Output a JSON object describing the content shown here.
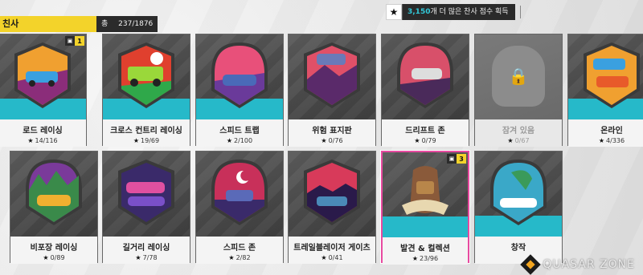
{
  "header": {
    "category_label": "친사",
    "total_label": "총",
    "total_value": "237/1876"
  },
  "notice": {
    "icon": "star-icon",
    "highlight": "3,150",
    "text": "개 더 많은 찬사 점수 획득"
  },
  "row1": [
    {
      "name": "로드 레이싱",
      "progress": "14/116",
      "count": "1",
      "icon": "road-racing-icon"
    },
    {
      "name": "크로스 컨트리 레이싱",
      "progress": "19/69",
      "icon": "cross-country-icon"
    },
    {
      "name": "스피드 트랩",
      "progress": "2/100",
      "icon": "speed-trap-icon"
    },
    {
      "name": "위험 표지판",
      "progress": "0/76",
      "icon": "danger-sign-icon"
    },
    {
      "name": "드리프트 존",
      "progress": "0/79",
      "icon": "drift-zone-icon"
    },
    {
      "name": "잠겨 있음",
      "progress": "0/67",
      "icon": "lock-icon",
      "locked": true
    },
    {
      "name": "온라인",
      "progress": "4/336",
      "icon": "online-icon"
    }
  ],
  "row2": [
    {
      "name": "비포장 레이싱",
      "progress": "0/89",
      "icon": "dirt-racing-icon"
    },
    {
      "name": "길거리 레이싱",
      "progress": "7/78",
      "icon": "street-racing-icon"
    },
    {
      "name": "스피드 존",
      "progress": "2/82",
      "icon": "speed-zone-icon"
    },
    {
      "name": "트레일블레이저 게이츠",
      "progress": "0/41",
      "icon": "trailblazer-icon"
    },
    {
      "name": "발견 & 컬렉션",
      "progress": "23/96",
      "count": "3",
      "icon": "discovery-icon",
      "selected": true
    },
    {
      "name": "창작",
      "progress": "",
      "icon": "creative-icon"
    }
  ],
  "watermark": "QUASAR ZONE",
  "colors": {
    "accent_yellow": "#f3d32a",
    "accent_teal": "#26b9c9",
    "selected_border": "#e84aa0"
  }
}
